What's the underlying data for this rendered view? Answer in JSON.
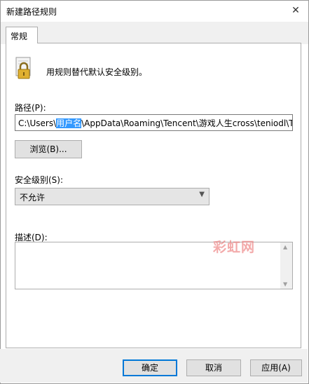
{
  "window": {
    "title": "新建路径规则"
  },
  "tabs": [
    {
      "label": "常规"
    }
  ],
  "info": {
    "text": "用规则替代默认安全级别。"
  },
  "path": {
    "label": "路径(P):",
    "value_before": "C:\\Users\\",
    "value_selected": "用户名",
    "value_after": "\\AppData\\Roaming\\Tencent\\游戏人生cross\\teniodl\\Teni"
  },
  "browse": {
    "label": "浏览(B)..."
  },
  "security_level": {
    "label": "安全级别(S):",
    "selected": "不允许"
  },
  "description": {
    "label": "描述(D):",
    "value": ""
  },
  "watermark": {
    "text": "彩虹网"
  },
  "buttons": {
    "ok": "确定",
    "cancel": "取消",
    "apply": "应用(A)"
  }
}
